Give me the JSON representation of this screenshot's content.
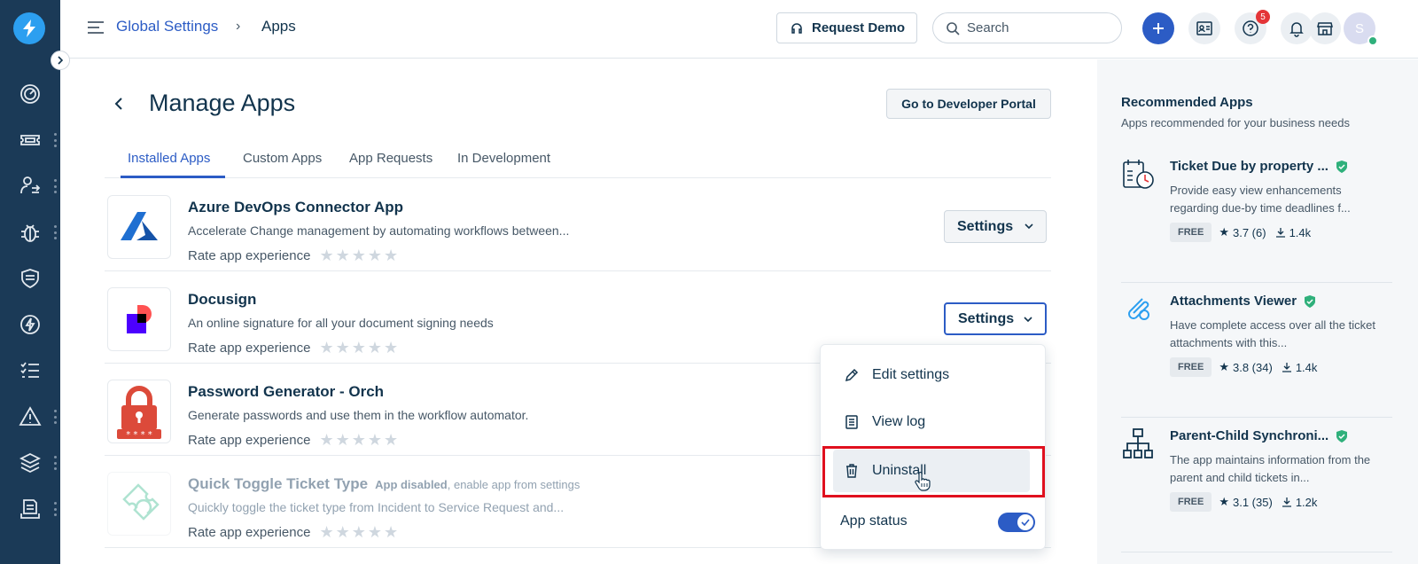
{
  "breadcrumb": {
    "parent": "Global Settings",
    "separator": "›",
    "current": "Apps"
  },
  "header": {
    "request_demo": "Request Demo",
    "search_placeholder": "Search",
    "help_badge": "5",
    "avatar_initial": "S"
  },
  "page": {
    "title": "Manage Apps",
    "developer_portal": "Go to Developer Portal",
    "tabs": [
      "Installed Apps",
      "Custom Apps",
      "App Requests",
      "In Development"
    ],
    "active_tab": "Installed Apps"
  },
  "apps": [
    {
      "name": "Azure DevOps Connector App",
      "description": "Accelerate Change management by automating workflows between...",
      "rate_label": "Rate app experience",
      "stars": "★★★★★",
      "button": "Settings"
    },
    {
      "name": "Docusign",
      "description": "An online signature for all your document signing needs",
      "rate_label": "Rate app experience",
      "stars": "★★★★★",
      "button": "Settings"
    },
    {
      "name": "Password Generator - Orch",
      "description": "Generate passwords and use them in the workflow automator.",
      "rate_label": "Rate app experience",
      "stars": "★★★★★"
    },
    {
      "name": "Quick Toggle Ticket Type",
      "disabled_strong": "App disabled",
      "disabled_rest": ", enable app from settings",
      "description": "Quickly toggle the ticket type from Incident to Service Request and...",
      "rate_label": "Rate app experience",
      "stars": "★★★★★"
    }
  ],
  "dropdown": {
    "edit": "Edit settings",
    "log": "View log",
    "uninstall": "Uninstall",
    "status_label": "App status",
    "status_on": true
  },
  "recommended": {
    "title": "Recommended Apps",
    "subtitle": "Apps recommended for your business needs",
    "items": [
      {
        "name": "Ticket Due by property ...",
        "description": "Provide easy view enhancements regarding due-by time deadlines f...",
        "price": "FREE",
        "rating": "3.7 (6)",
        "downloads": "1.4k"
      },
      {
        "name": "Attachments Viewer",
        "description": "Have complete access over all the ticket attachments with this...",
        "price": "FREE",
        "rating": "3.8 (34)",
        "downloads": "1.4k"
      },
      {
        "name": "Parent-Child Synchroni...",
        "description": "The app maintains information from the parent and child tickets in...",
        "price": "FREE",
        "rating": "3.1 (35)",
        "downloads": "1.2k"
      }
    ]
  },
  "colors": {
    "rail": "#1b3a57",
    "accent": "#2c5cc5",
    "highlight_box": "#e0101e",
    "verified": "#2fb07b"
  }
}
